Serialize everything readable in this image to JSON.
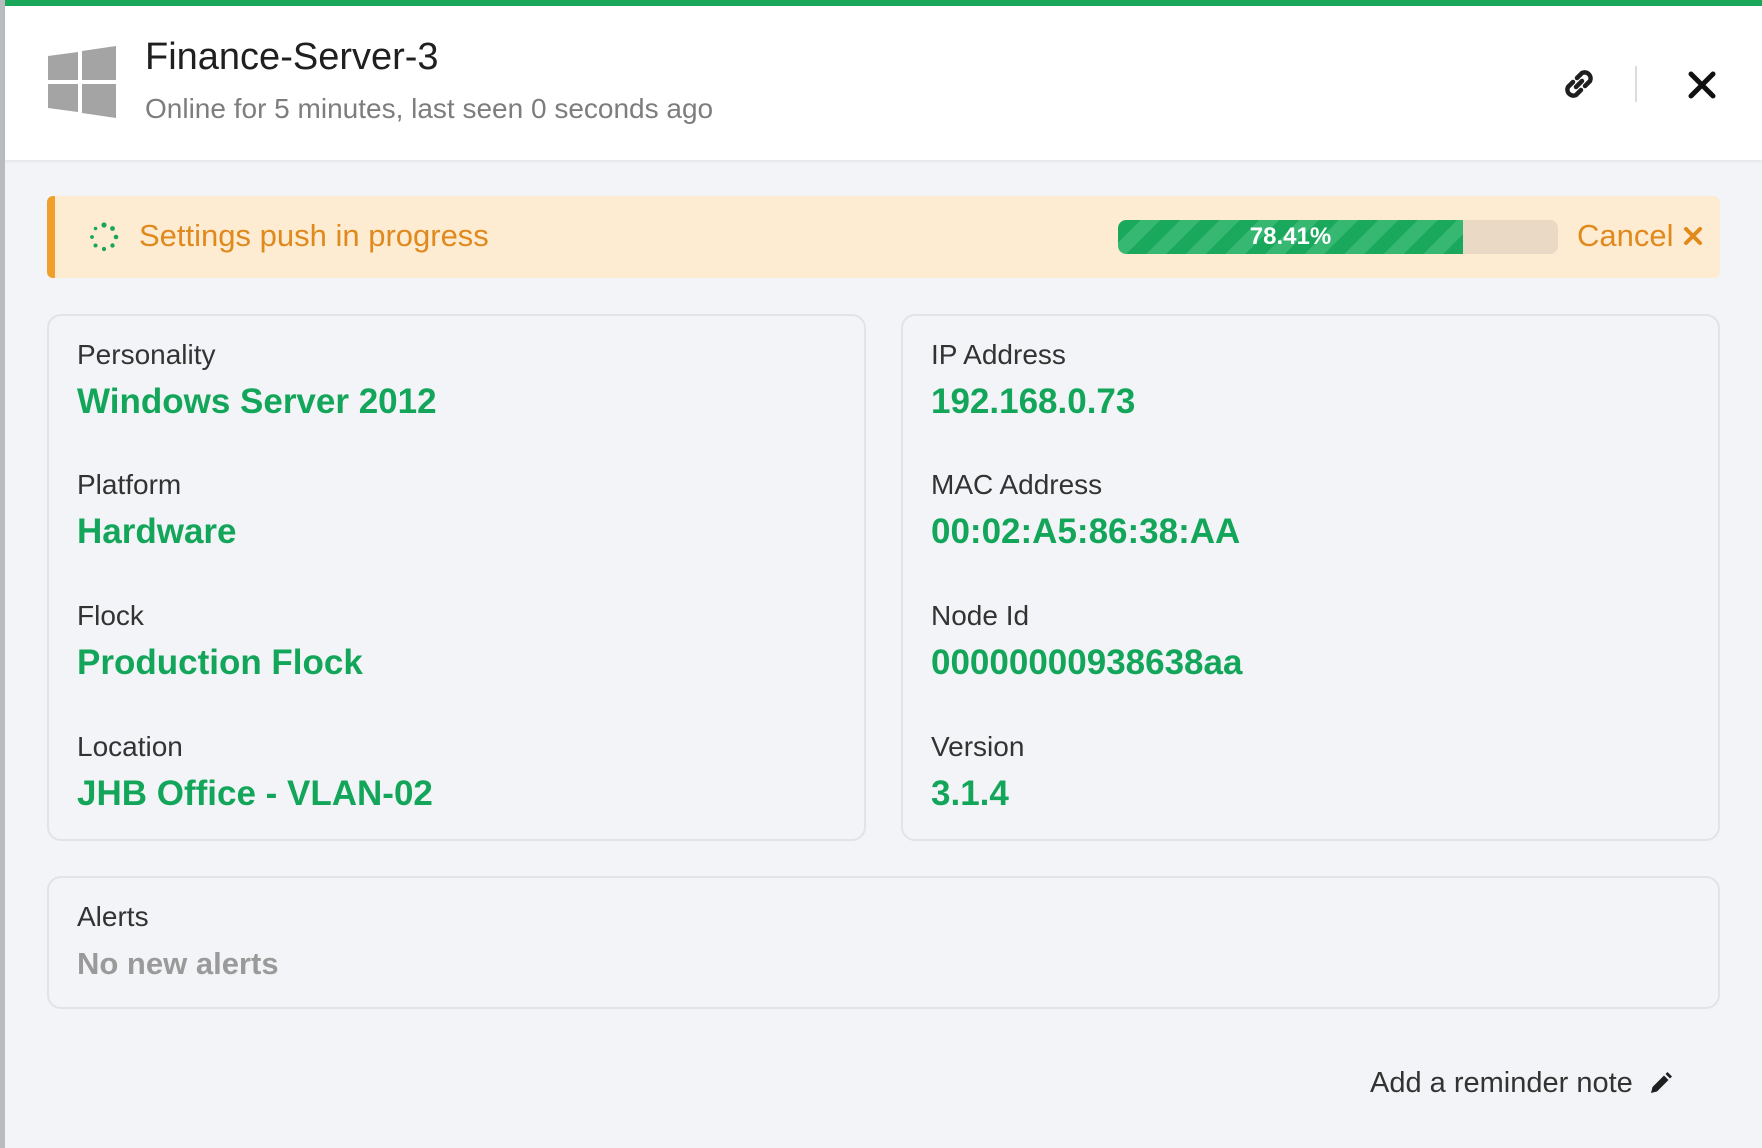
{
  "header": {
    "title": "Finance-Server-3",
    "subtitle": "Online for 5 minutes, last seen 0 seconds ago",
    "os_icon": "windows-logo-icon",
    "link_icon": "link-icon",
    "close_icon": "close-icon"
  },
  "push_banner": {
    "label": "Settings push in progress",
    "progress_text": "78.41%",
    "progress_fraction": 0.7841,
    "cancel_label": "Cancel",
    "spinner_icon": "spinner-icon",
    "cancel_icon": "close-x-icon"
  },
  "details_left": [
    {
      "label": "Personality",
      "value": "Windows Server 2012"
    },
    {
      "label": "Platform",
      "value": "Hardware"
    },
    {
      "label": "Flock",
      "value": "Production Flock"
    },
    {
      "label": "Location",
      "value": "JHB Office - VLAN-02"
    }
  ],
  "details_right": [
    {
      "label": "IP Address",
      "value": "192.168.0.73"
    },
    {
      "label": "MAC Address",
      "value": "00:02:A5:86:38:AA"
    },
    {
      "label": "Node Id",
      "value": "00000000938638aa"
    },
    {
      "label": "Version",
      "value": "3.1.4"
    }
  ],
  "alerts": {
    "label": "Alerts",
    "value": "No new alerts"
  },
  "reminder": {
    "label": "Add a reminder note",
    "icon": "pencil-icon"
  },
  "colors": {
    "accent_green": "#13a65a",
    "warning_orange": "#e08a1e",
    "banner_bg": "#fdecd2"
  }
}
